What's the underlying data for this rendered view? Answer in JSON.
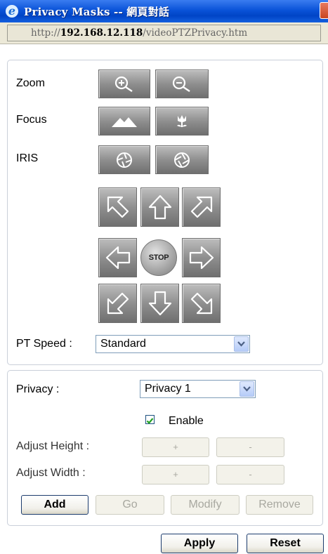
{
  "window": {
    "title": "Privacy Masks -- 網頁對話",
    "url_prefix": "http://",
    "url_host": "192.168.12.118",
    "url_path": "/videoPTZPrivacy.htm"
  },
  "ptz": {
    "zoom_label": "Zoom",
    "focus_label": "Focus",
    "iris_label": "IRIS",
    "stop_label": "STOP",
    "speed_label": "PT Speed :",
    "speed_value": "Standard"
  },
  "privacy": {
    "privacy_label": "Privacy :",
    "privacy_value": "Privacy 1",
    "enable_label": "Enable",
    "enable_checked": true,
    "adjust_height_label": "Adjust Height :",
    "adjust_width_label": "Adjust Width :",
    "plus_label": "+",
    "minus_label": "-",
    "add_label": "Add",
    "go_label": "Go",
    "modify_label": "Modify",
    "remove_label": "Remove"
  },
  "footer": {
    "apply_label": "Apply",
    "reset_label": "Reset"
  },
  "icons": {
    "zoom_in": "zoom-in-icon",
    "zoom_out": "zoom-out-icon",
    "focus_far": "mountain-icon",
    "focus_near": "flower-icon",
    "iris_close": "iris-close-icon",
    "iris_open": "iris-open-icon"
  }
}
